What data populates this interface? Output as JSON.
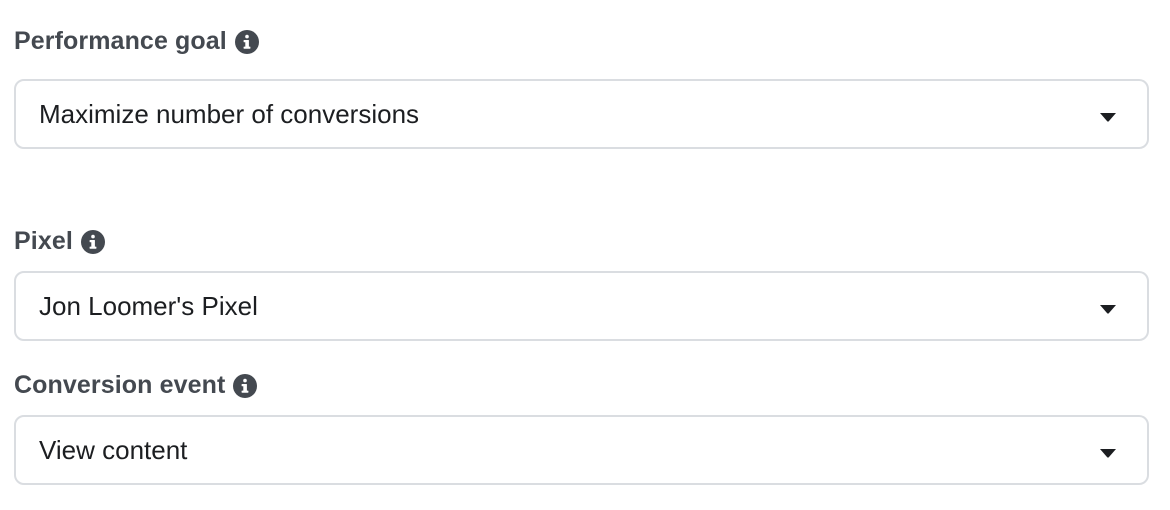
{
  "performance_goal": {
    "label": "Performance goal",
    "info_icon": "info-icon",
    "value": "Maximize number of conversions",
    "caret_icon": "caret-down-icon"
  },
  "pixel": {
    "label": "Pixel",
    "info_icon": "info-icon",
    "value": "Jon Loomer's Pixel",
    "caret_icon": "caret-down-icon"
  },
  "conversion_event": {
    "label": "Conversion event",
    "info_icon": "info-icon",
    "value": "View content",
    "caret_icon": "caret-down-icon"
  },
  "colors": {
    "label_text": "#444950",
    "value_text": "#1c1e21",
    "border": "#dadde1",
    "icon": "#444950"
  }
}
